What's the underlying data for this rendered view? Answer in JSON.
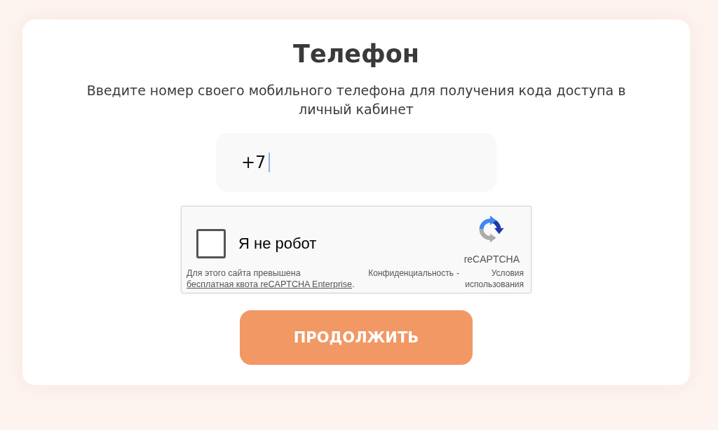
{
  "title": "Телефон",
  "description": "Введите номер своего мобильного телефона для получения кода доступа в личный кабинет",
  "phone_field": {
    "value": "+7",
    "focused": true
  },
  "captcha": {
    "label": "Я не робот",
    "checked": false,
    "notice": "Для этого сайта превышена",
    "notice_link": "бесплатная квота reCAPTCHA Enterprise",
    "notice_end": ".",
    "brand": "reCAPTCHA",
    "privacy_link": "Конфиденциальность",
    "separator": "-",
    "terms_link": "Условия использования"
  },
  "submit_button": "ПРОДОЛЖИТЬ"
}
